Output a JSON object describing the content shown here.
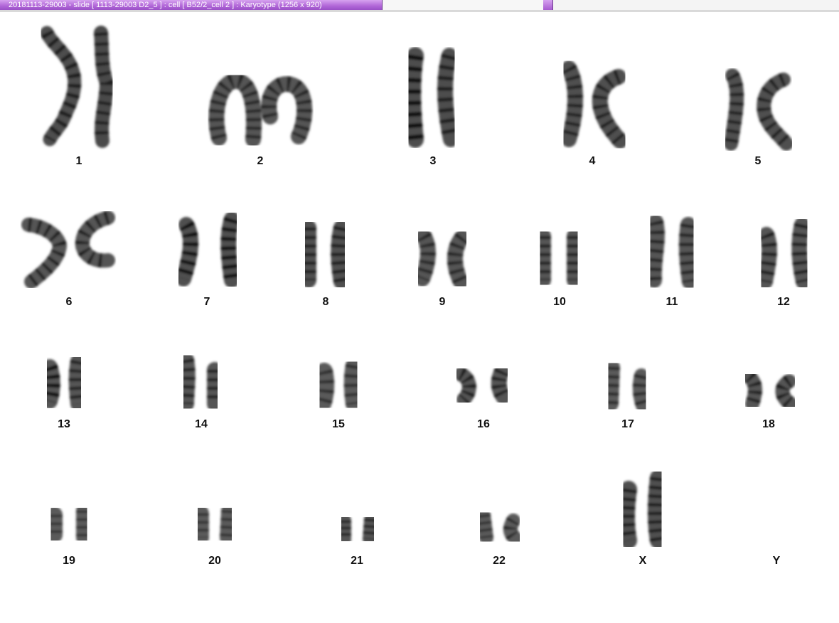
{
  "window": {
    "title": "20181113-29003 - slide [ 1113-29003 D2_5 ] : cell [ B52/2_cell 2 ] : Karyotype  (1256 x 920)"
  },
  "karyotype": {
    "chromosomes": [
      "1",
      "2",
      "3",
      "4",
      "5",
      "6",
      "7",
      "8",
      "9",
      "10",
      "11",
      "12",
      "13",
      "14",
      "15",
      "16",
      "17",
      "18",
      "19",
      "20",
      "21",
      "22",
      "X",
      "Y"
    ]
  }
}
